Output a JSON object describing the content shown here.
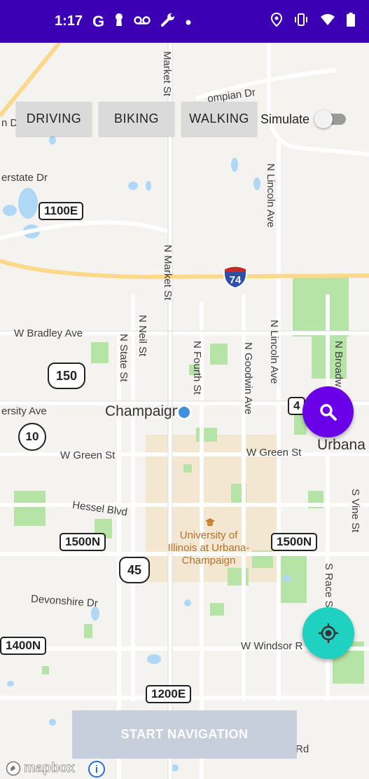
{
  "status_bar": {
    "time": "1:17",
    "left_icons": [
      "google-icon",
      "keyhole-icon",
      "voicemail-icon",
      "wrench-icon",
      "dot-icon"
    ],
    "right_icons": [
      "location-icon",
      "vibrate-icon",
      "wifi-icon",
      "battery-icon"
    ],
    "background": "#3b00b3"
  },
  "mode_buttons": {
    "driving": "DRIVING",
    "biking": "BIKING",
    "walking": "WALKING"
  },
  "simulate": {
    "label": "Simulate",
    "enabled": false
  },
  "map": {
    "street_labels": {
      "market_st_top": "Market St",
      "ompian_dr": "ompian Dr",
      "dr_left": "n Dr",
      "erstate_dr": "erstate Dr",
      "n_lincoln_ave_top": "N Lincoln Ave",
      "n_market_st": "N Market St",
      "w_bradley_ave": "W Bradley Ave",
      "n_neil_st": "N Neil St",
      "n_state_st": "N State St",
      "n_fourth_st": "N Fourth St",
      "n_goodwin_ave": "N Goodwin Ave",
      "n_lincoln_ave": "N Lincoln Ave",
      "n_broadway": "N Broadw",
      "ersity_ave": "ersity Ave",
      "w_green_st_left": "W Green St",
      "w_green_st_right": "W Green St",
      "hessel_blvd": "Hessel Blvd",
      "s_vine_st": "S Vine St",
      "s_race_st": "S Race S",
      "devonshire_dr": "Devonshire Dr",
      "w_windsor": "W Windsor R",
      "rd_bottom": "Rd"
    },
    "city_labels": {
      "champaign": "Champaign",
      "urbana": "Urbana"
    },
    "campus_label": "University of Illinois at Urbana-Champaign",
    "shields": {
      "r1100e": "1100E",
      "i74": "74",
      "us150": "150",
      "r10": "10",
      "us45": "45",
      "r1500n_left": "1500N",
      "r1500n_right": "1500N",
      "r1400n": "1400N",
      "r1200e": "1200E",
      "r4": "4"
    },
    "colors": {
      "background": "#f4f3f0",
      "highway": "#fcd98a",
      "park": "#b6e3a6",
      "water": "#aed8f5",
      "campus": "#f3e7d2",
      "location_dot": "#3f8fe0"
    }
  },
  "fabs": {
    "search": {
      "icon": "search-icon",
      "color": "#6a00e8"
    },
    "locate": {
      "icon": "my-location-icon",
      "color": "#1fd1c1"
    }
  },
  "start_navigation": {
    "label": "START NAVIGATION"
  },
  "attribution": {
    "logo": "mapbox",
    "info_icon": "info-icon"
  }
}
